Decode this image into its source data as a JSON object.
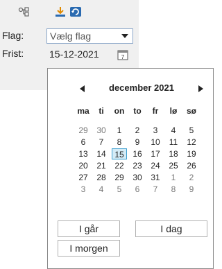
{
  "toolbar": {
    "icons": [
      "link-icon",
      "download-icon",
      "refresh-icon"
    ]
  },
  "form": {
    "flag_label": "Flag:",
    "flag_value": "Vælg flag",
    "due_label": "Frist:",
    "due_value": "15-12-2021"
  },
  "calendar": {
    "month_label": "december 2021",
    "weekdays": [
      "ma",
      "ti",
      "on",
      "to",
      "fr",
      "lø",
      "sø"
    ],
    "weeks": [
      [
        "29",
        "30",
        "1",
        "2",
        "3",
        "4",
        "5"
      ],
      [
        "6",
        "7",
        "8",
        "9",
        "10",
        "11",
        "12"
      ],
      [
        "13",
        "14",
        "15",
        "16",
        "17",
        "18",
        "19"
      ],
      [
        "20",
        "21",
        "22",
        "23",
        "24",
        "25",
        "26"
      ],
      [
        "27",
        "28",
        "29",
        "30",
        "31",
        "1",
        "2"
      ],
      [
        "3",
        "4",
        "5",
        "6",
        "7",
        "8",
        "9"
      ]
    ],
    "selected_day": "15",
    "buttons": {
      "yesterday": "I går",
      "today": "I dag",
      "tomorrow": "I morgen"
    }
  }
}
